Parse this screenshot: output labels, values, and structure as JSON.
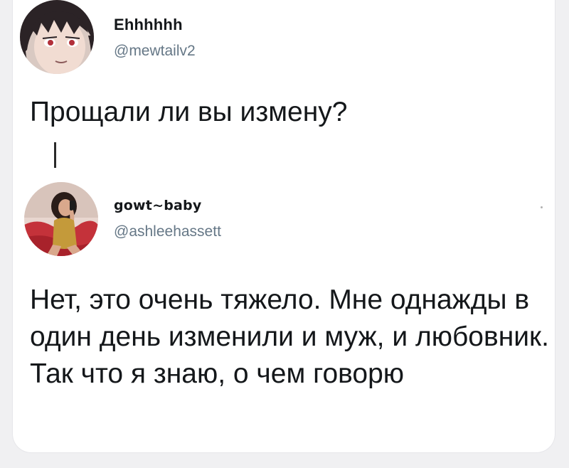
{
  "tweets": [
    {
      "display_name": "Ehhhhhh",
      "handle": "@mewtailv2",
      "text": "Прощали ли вы измену?",
      "avatar_icon": "anime-girl-avatar-icon"
    },
    {
      "display_name": "gowt~baby",
      "handle": "@ashleehassett",
      "text": "Нет, это очень тяжело. Мне однажды в один день изменили и муж, и любовник. Так что я знаю, о чем говорю",
      "avatar_icon": "woman-selfie-avatar-icon"
    }
  ],
  "colors": {
    "background": "#f0f0f2",
    "card": "#ffffff",
    "text": "#14171a",
    "handle": "#657786"
  }
}
